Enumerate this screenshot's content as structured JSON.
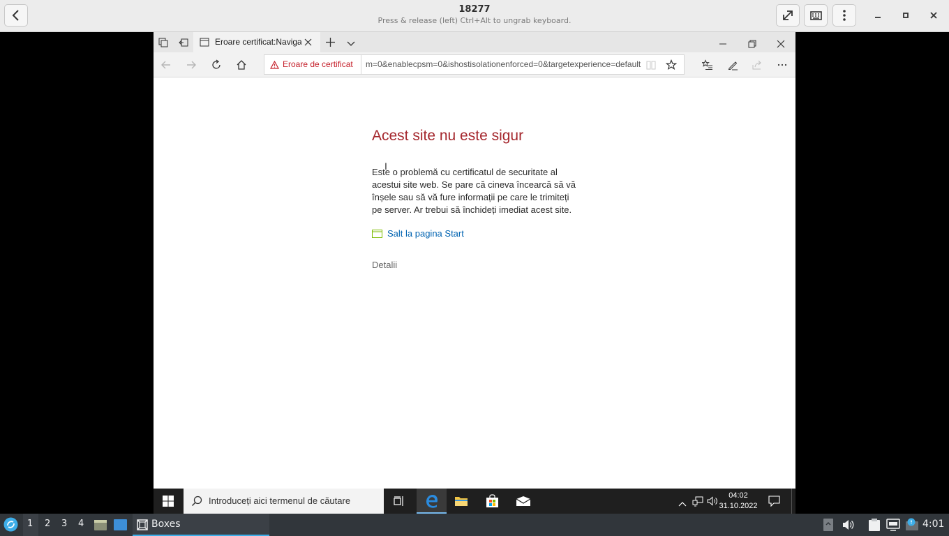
{
  "boxes": {
    "title": "18277",
    "subtitle": "Press & release (left) Ctrl+Alt to ungrab keyboard."
  },
  "edge": {
    "tab_title": "Eroare certificat:Navigat",
    "address": {
      "warning": "Eroare de certificat",
      "url": "m=0&enablecpsm=0&ishostisolationenforced=0&targetexperience=default"
    }
  },
  "page": {
    "title": "Acest site nu este sigur",
    "body": "Este o problemă cu certificatul de securitate al acestui site web. Se pare că cineva încearcă să vă înșele sau să vă fure informații pe care le trimiteți pe server. Ar trebui să închideți imediat acest site.",
    "link": "Salt la pagina Start",
    "details": "Detalii"
  },
  "windows_taskbar": {
    "search_placeholder": "Introduceți aici termenul de căutare",
    "time": "04:02",
    "date": "31.10.2022"
  },
  "host_panel": {
    "workspaces": [
      "1",
      "2",
      "3",
      "4"
    ],
    "active_task": "Boxes",
    "clock": "4:01"
  },
  "colors": {
    "error_red": "#a4262c",
    "link_blue": "#0063b1",
    "edge_accent": "#0078d7",
    "host_accent": "#3daee9"
  }
}
